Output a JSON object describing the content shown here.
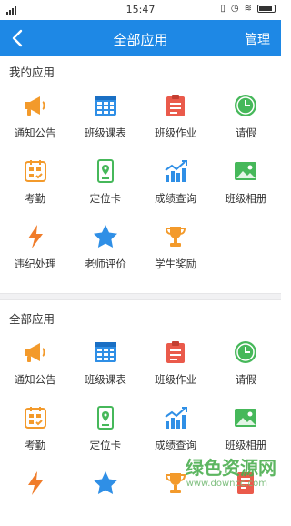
{
  "status_bar": {
    "time": "15:47"
  },
  "header": {
    "title": "全部应用",
    "manage_label": "管理"
  },
  "my_apps": {
    "title": "我的应用",
    "items": [
      {
        "label": "通知公告",
        "icon": "megaphone-icon"
      },
      {
        "label": "班级课表",
        "icon": "timetable-icon"
      },
      {
        "label": "班级作业",
        "icon": "clipboard-icon"
      },
      {
        "label": "请假",
        "icon": "clock-icon"
      },
      {
        "label": "考勤",
        "icon": "attendance-icon"
      },
      {
        "label": "定位卡",
        "icon": "location-card-icon"
      },
      {
        "label": "成绩查询",
        "icon": "chart-icon"
      },
      {
        "label": "班级相册",
        "icon": "album-icon"
      },
      {
        "label": "违纪处理",
        "icon": "lightning-icon"
      },
      {
        "label": "老师评价",
        "icon": "star-icon"
      },
      {
        "label": "学生奖励",
        "icon": "trophy-icon"
      }
    ]
  },
  "all_apps": {
    "title": "全部应用",
    "items": [
      {
        "label": "通知公告",
        "icon": "megaphone-icon"
      },
      {
        "label": "班级课表",
        "icon": "timetable-icon"
      },
      {
        "label": "班级作业",
        "icon": "clipboard-icon"
      },
      {
        "label": "请假",
        "icon": "clock-icon"
      },
      {
        "label": "考勤",
        "icon": "attendance-icon"
      },
      {
        "label": "定位卡",
        "icon": "location-card-icon"
      },
      {
        "label": "成绩查询",
        "icon": "chart-icon"
      },
      {
        "label": "班级相册",
        "icon": "album-icon"
      },
      {
        "label": "",
        "icon": "lightning-icon"
      },
      {
        "label": "",
        "icon": "star-icon"
      },
      {
        "label": "",
        "icon": "trophy-icon"
      },
      {
        "label": "",
        "icon": "document-icon"
      }
    ]
  },
  "watermark": {
    "title": "绿色资源网",
    "url": "www.downcc.com"
  },
  "colors": {
    "nav": "#1e88e5",
    "orange": "#f39a2b",
    "blue": "#2f8fe6",
    "red": "#ea5a4b",
    "green": "#46b85a"
  }
}
